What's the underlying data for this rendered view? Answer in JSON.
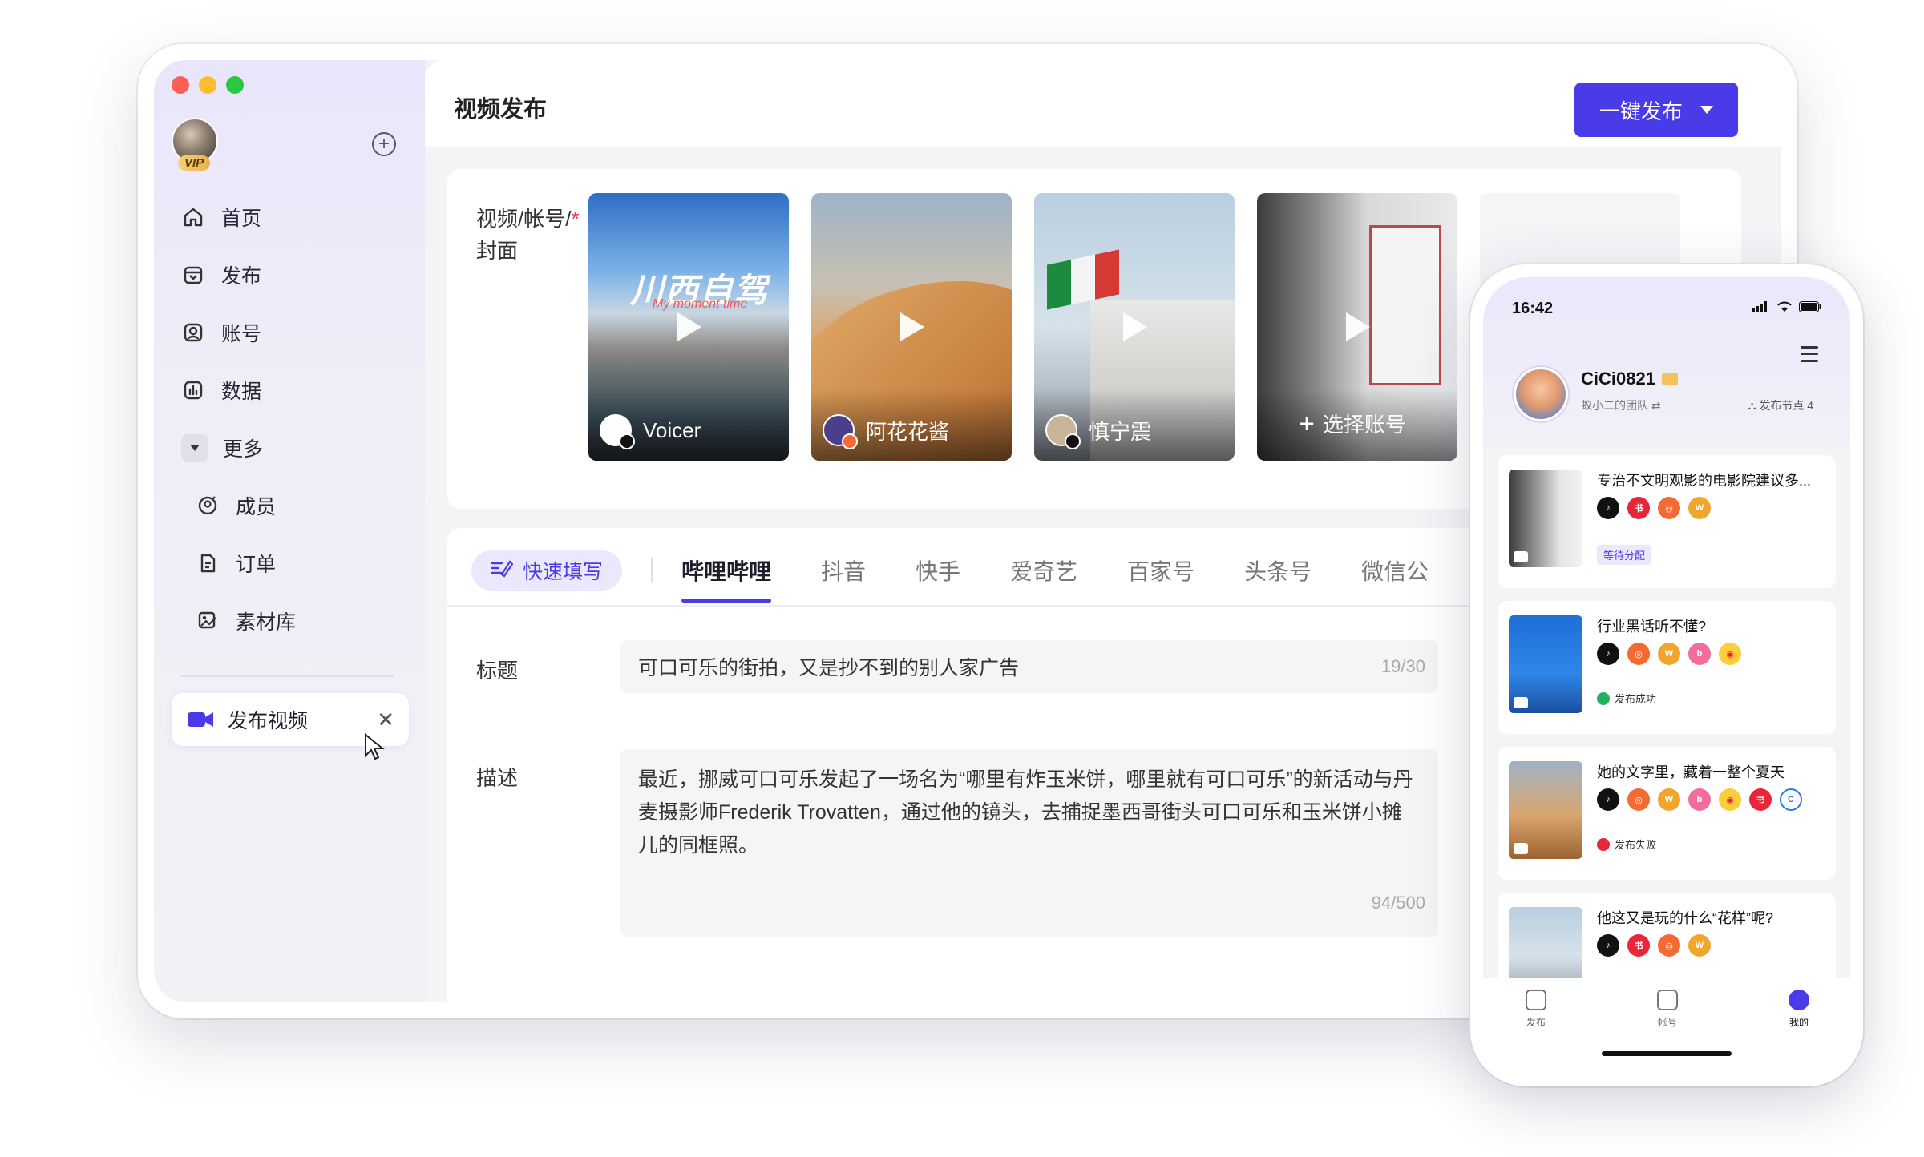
{
  "sidebar": {
    "vip": "VIP",
    "add_icon": "plus-circle-icon",
    "items": [
      {
        "label": "首页",
        "icon": "home-icon"
      },
      {
        "label": "发布",
        "icon": "publish-icon"
      },
      {
        "label": "账号",
        "icon": "account-icon"
      },
      {
        "label": "数据",
        "icon": "chart-icon"
      },
      {
        "label": "更多",
        "icon": "caret-down-icon"
      },
      {
        "label": "成员",
        "icon": "members-icon"
      },
      {
        "label": "订单",
        "icon": "order-icon"
      },
      {
        "label": "素材库",
        "icon": "library-icon"
      }
    ],
    "active_tab": {
      "label": "发布视频",
      "icon": "video-camera-icon",
      "close": "✕"
    }
  },
  "header": {
    "title": "视频发布",
    "publish_button": "一键发布"
  },
  "media": {
    "label_line1": "视频/帐号/",
    "required_mark": "*",
    "label_line2": "封面",
    "thumbs": [
      {
        "owner": "Voicer",
        "overlay_title": "川西自驾",
        "overlay_sub": "My moment time"
      },
      {
        "owner": "阿花花酱"
      },
      {
        "owner": "慎宁震"
      },
      {
        "owner": "选择账号"
      }
    ]
  },
  "tabs": {
    "quick_fill": "快速填写",
    "items": [
      "哔哩哔哩",
      "抖音",
      "快手",
      "爱奇艺",
      "百家号",
      "头条号",
      "微信公"
    ]
  },
  "form": {
    "title_label": "标题",
    "title_value": "可口可乐的街拍，又是抄不到的别人家广告",
    "title_count": "19/30",
    "desc_label": "描述",
    "desc_value": "最近，挪威可口可乐发起了一场名为“哪里有炸玉米饼，哪里就有可口可乐”的新活动与丹麦摄影师Frederik Trovatten，通过他的镜头，去捕捉墨西哥街头可口可乐和玉米饼小摊儿的同框照。",
    "desc_count": "94/500"
  },
  "phone": {
    "time": "16:42",
    "user_name": "CiCi0821",
    "team": "蚁小二的团队 ⇄",
    "node": "⛬ 发布节点 4",
    "posts": [
      {
        "title": "专治不文明观影的电影院建议多...",
        "status": "等待分配",
        "state": "pending"
      },
      {
        "title": "行业黑话听不懂?",
        "status": "发布成功",
        "state": "ok"
      },
      {
        "title": "她的文字里，藏着一整个夏天",
        "status": "发布失败",
        "state": "err"
      },
      {
        "title": "他这又是玩的什么“花样”呢?",
        "status": "",
        "state": ""
      }
    ],
    "tabbar": [
      "发布",
      "帐号",
      "我的"
    ]
  },
  "colors": {
    "accent": "#4a3be8",
    "required": "#e5394b",
    "success": "#1fb35f",
    "error": "#e8263a"
  }
}
